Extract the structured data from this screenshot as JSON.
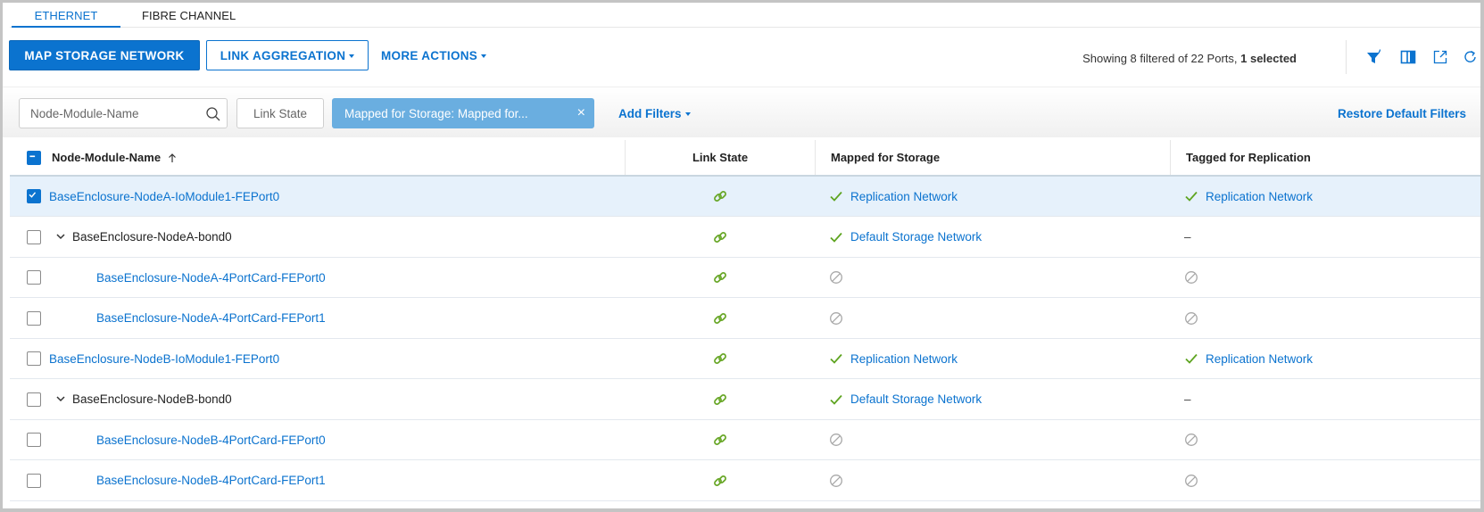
{
  "tabs": [
    {
      "label": "ETHERNET",
      "active": true
    },
    {
      "label": "FIBRE CHANNEL",
      "active": false
    }
  ],
  "toolbar": {
    "map_storage_label": "MAP STORAGE NETWORK",
    "link_aggregation_label": "LINK AGGREGATION",
    "more_actions_label": "MORE ACTIONS",
    "summary_prefix": "Showing 8 filtered of 22 Ports, ",
    "summary_selected": "1 selected",
    "icons": [
      "filter-icon",
      "columns-icon",
      "export-icon",
      "refresh-icon"
    ]
  },
  "filters": {
    "search_placeholder": "Node-Module-Name",
    "search_value": "",
    "link_state_label": "Link State",
    "active_chip_label": "Mapped for Storage: Mapped for...",
    "chip_close": "×",
    "add_filters_label": "Add Filters",
    "restore_label": "Restore Default Filters"
  },
  "colors": {
    "accent": "#0b73cf",
    "chip": "#6aaee0",
    "link_ok": "#6aa82a",
    "check": "#5ea420",
    "not_allowed": "#a8a8a8",
    "selected_row": "#e6f1fb"
  },
  "table": {
    "columns": [
      {
        "label": "Node-Module-Name",
        "sort": "ascending"
      },
      {
        "label": "Link State"
      },
      {
        "label": "Mapped for Storage"
      },
      {
        "label": "Tagged for Replication"
      }
    ],
    "rows": [
      {
        "name": "BaseEnclosure-NodeA-IoModule1-FEPort0",
        "type": "port",
        "indent": 0,
        "selected": true,
        "link": "up",
        "mapped": {
          "state": "check",
          "text": "Replication Network"
        },
        "tagged": {
          "state": "check",
          "text": "Replication Network"
        }
      },
      {
        "name": "BaseEnclosure-NodeA-bond0",
        "type": "bond",
        "indent": 0,
        "expanded": true,
        "selected": false,
        "link": "up",
        "mapped": {
          "state": "check",
          "text": "Default Storage Network"
        },
        "tagged": {
          "state": "dash",
          "text": "–"
        }
      },
      {
        "name": "BaseEnclosure-NodeA-4PortCard-FEPort0",
        "type": "port",
        "indent": 1,
        "selected": false,
        "link": "up",
        "mapped": {
          "state": "none",
          "text": ""
        },
        "tagged": {
          "state": "none",
          "text": ""
        }
      },
      {
        "name": "BaseEnclosure-NodeA-4PortCard-FEPort1",
        "type": "port",
        "indent": 1,
        "selected": false,
        "link": "up",
        "mapped": {
          "state": "none",
          "text": ""
        },
        "tagged": {
          "state": "none",
          "text": ""
        }
      },
      {
        "name": "BaseEnclosure-NodeB-IoModule1-FEPort0",
        "type": "port",
        "indent": 0,
        "selected": false,
        "link": "up",
        "mapped": {
          "state": "check",
          "text": "Replication Network"
        },
        "tagged": {
          "state": "check",
          "text": "Replication Network"
        }
      },
      {
        "name": "BaseEnclosure-NodeB-bond0",
        "type": "bond",
        "indent": 0,
        "expanded": true,
        "selected": false,
        "link": "up",
        "mapped": {
          "state": "check",
          "text": "Default Storage Network"
        },
        "tagged": {
          "state": "dash",
          "text": "–"
        }
      },
      {
        "name": "BaseEnclosure-NodeB-4PortCard-FEPort0",
        "type": "port",
        "indent": 1,
        "selected": false,
        "link": "up",
        "mapped": {
          "state": "none",
          "text": ""
        },
        "tagged": {
          "state": "none",
          "text": ""
        }
      },
      {
        "name": "BaseEnclosure-NodeB-4PortCard-FEPort1",
        "type": "port",
        "indent": 1,
        "selected": false,
        "link": "up",
        "mapped": {
          "state": "none",
          "text": ""
        },
        "tagged": {
          "state": "none",
          "text": ""
        }
      }
    ]
  }
}
